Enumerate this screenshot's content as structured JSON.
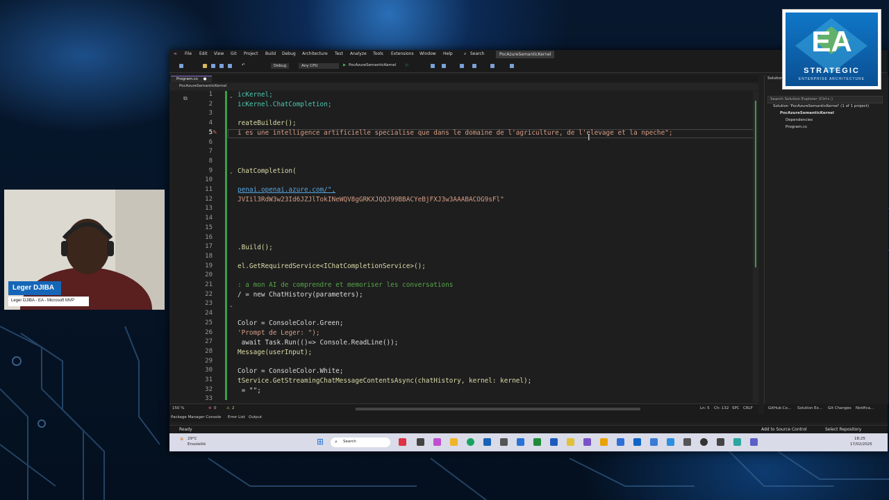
{
  "menu": [
    "File",
    "Edit",
    "View",
    "Git",
    "Project",
    "Build",
    "Debug",
    "Architecture",
    "Test",
    "Analyze",
    "Tools",
    "Extensions",
    "Window",
    "Help"
  ],
  "search_label": "Search",
  "solution_title": "PocAzureSemanticKernel",
  "toolbar": {
    "config": "Debug",
    "platform": "Any CPU",
    "run_target": "PocAzureSemanticKernel"
  },
  "doc_tab": "Program.cs",
  "nav_project": "PocAzureSemanticKernel",
  "line_numbers": [
    "1",
    "2",
    "3",
    "4",
    "5",
    "6",
    "7",
    "8",
    "9",
    "10",
    "11",
    "12",
    "13",
    "14",
    "15",
    "16",
    "17",
    "18",
    "19",
    "20",
    "21",
    "22",
    "23",
    "24",
    "25",
    "26",
    "27",
    "28",
    "29",
    "30",
    "31",
    "32",
    "33"
  ],
  "code": {
    "l1": "icKernel;",
    "l2": "icKernel.ChatCompletion;",
    "l4": "reateBuilder();",
    "l5": "i es une intelligence artificielle specialise que dans le domaine de l'agriculture, de l'elevage et la npeche\";",
    "l9": "ChatCompletion(",
    "l11": "penai.openai.azure.com/\",",
    "l12": "JVIil3RdW3w23Id6JZJlTokINeWQV8gGRKXJQQJ99BBACYeBjFXJ3w3AAABACOG9sFl\"",
    "l17": ".Build();",
    "l19": "el.GetRequiredService<IChatCompletionService>();",
    "l21": ": a mon AI de comprendre et memoriser les conversations",
    "l22": "/ = new ChatHistory(parameters);",
    "l26": "Color = ConsoleColor.Green;",
    "l27": "'Prompt de Leger: \");",
    "l28": " await Task.Run(()=> Console.ReadLine());",
    "l29": "Message(userInput);",
    "l31": "Color = ConsoleColor.White;",
    "l32": "tService.GetStreamingChatMessageContentsAsync(chatHistory, kernel: kernel);",
    "l33": " = \"\";"
  },
  "editor_status": {
    "zoom": "150 %",
    "errors": "0",
    "warnings": "2",
    "ln": "Ln: 5",
    "ch": "Ch: 132",
    "spc": "SPC",
    "crlf": "CRLF"
  },
  "output_tabs": [
    "Package Manager Console",
    "Error List",
    "Output"
  ],
  "solution_explorer": {
    "header": "Solution Explorer",
    "search_placeholder": "Search Solution Explorer (Ctrl+;)",
    "solution_line": "Solution 'PocAzureSemanticKernel' (1 of 1 project)",
    "project": "PocAzureSemanticKernel",
    "dependencies": "Dependencies",
    "program": "Program.cs"
  },
  "side_tabs": [
    "GitHub Co...",
    "Solution Ex...",
    "Git Changes",
    "Notifica..."
  ],
  "vs_status": {
    "ready": "Ready",
    "add_source": "Add to Source Control",
    "select_repo": "Select Repository"
  },
  "taskbar": {
    "temp": "29°C",
    "weather": "Ensoleillé",
    "search": "Search",
    "time": "18:25",
    "date": "17/02/2025"
  },
  "presenter": {
    "name": "Leger DJIBA",
    "subtitle": "Leger DJIBA - EA - Microsoft MVP"
  },
  "logo": {
    "main": "EA",
    "line1": "STRATEGIC",
    "line2": "ENTERPRISE ARCHITECTURE"
  }
}
